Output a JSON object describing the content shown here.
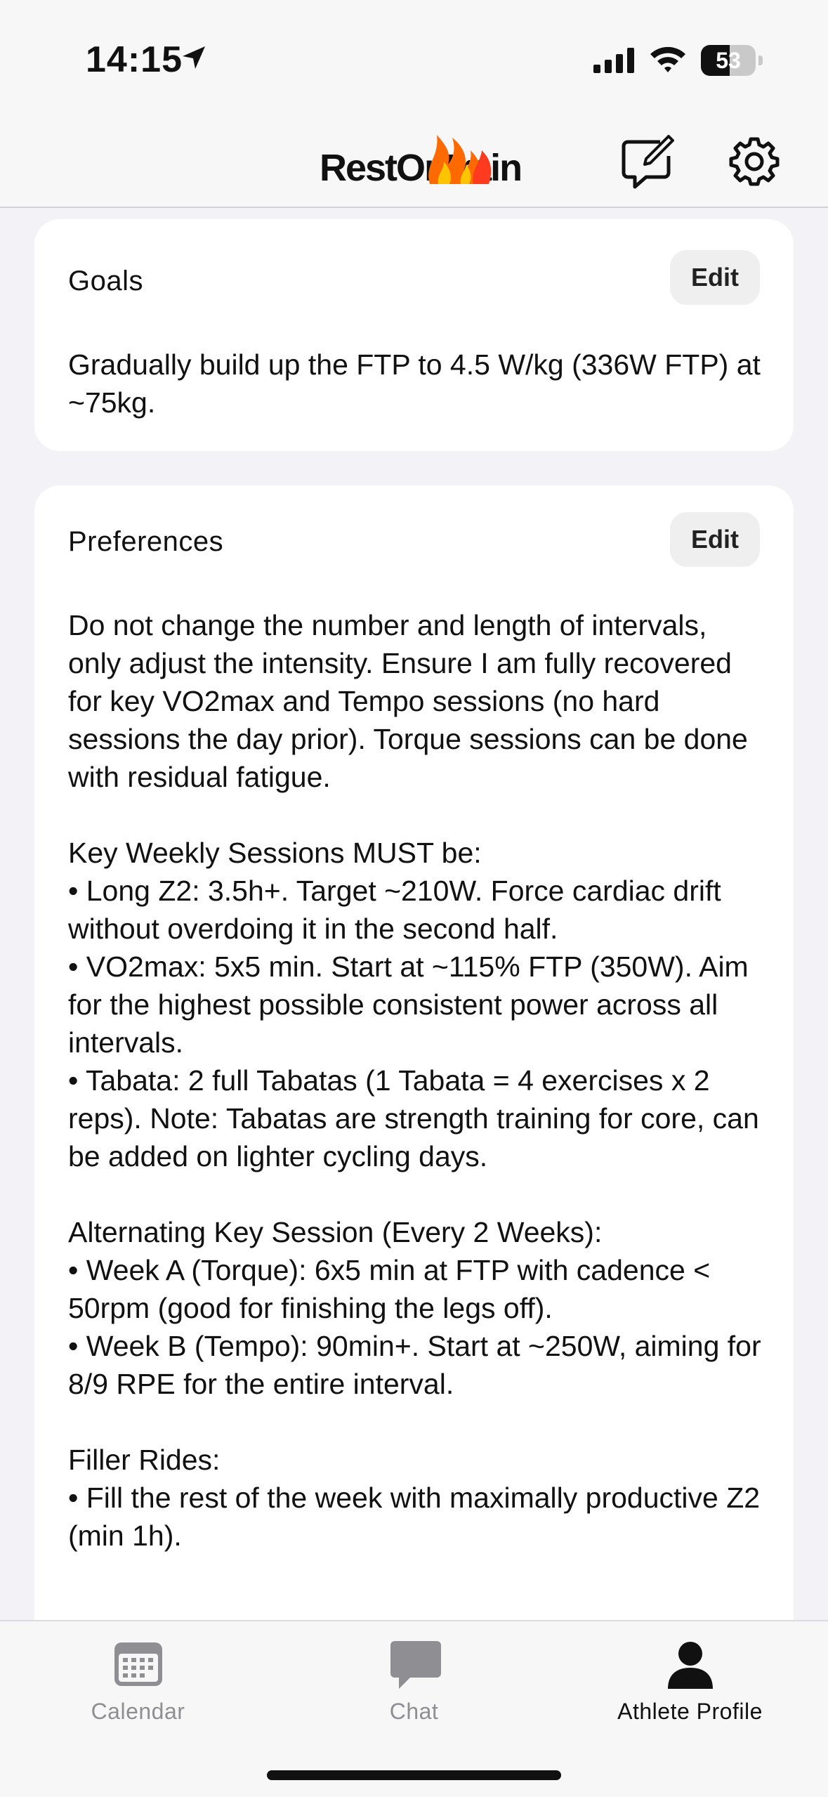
{
  "status_bar": {
    "time": "14:15",
    "battery_level": "53",
    "battery_fraction": 0.53
  },
  "header": {
    "app_name": "RestOrTrain"
  },
  "goals": {
    "title": "Goals",
    "edit_label": "Edit",
    "text": "Gradually build up the FTP to 4.5 W/kg (336W FTP) at ~75kg."
  },
  "preferences": {
    "title": "Preferences",
    "edit_label": "Edit",
    "text": "Do not change the number and length of intervals, only adjust the intensity. Ensure I am fully recovered for key VO2max and Tempo sessions (no hard sessions the day prior). Torque sessions can be done with residual fatigue.\n\nKey Weekly Sessions MUST be:\n• Long Z2: 3.5h+. Target ~210W. Force cardiac drift without overdoing it in the second half.\n• VO2max: 5x5 min. Start at ~115% FTP (350W). Aim for the highest possible consistent power across all intervals.\n• Tabata: 2 full Tabatas (1 Tabata = 4 exercises x 2 reps). Note: Tabatas are strength training for core, can be added on lighter cycling days.\n\nAlternating Key Session (Every 2 Weeks):\n• Week A (Torque): 6x5 min at FTP with cadence < 50rpm (good for finishing the legs off).\n• Week B (Tempo): 90min+. Start at ~250W, aiming for 8/9 RPE for the entire interval.\n\nFiller Rides:\n• Fill the rest of the week with maximally productive Z2 (min 1h)."
  },
  "tabs": [
    {
      "label": "Calendar",
      "icon": "calendar-icon",
      "active": false
    },
    {
      "label": "Chat",
      "icon": "chat-icon",
      "active": false
    },
    {
      "label": "Athlete Profile",
      "icon": "person-icon",
      "active": true
    }
  ],
  "colors": {
    "background": "#f2f2f7",
    "card": "#ffffff",
    "inactive_tab": "#8e8e93",
    "active_tab": "#111111",
    "flame_orange": "#ff6a00",
    "flame_yellow": "#ffc400"
  }
}
